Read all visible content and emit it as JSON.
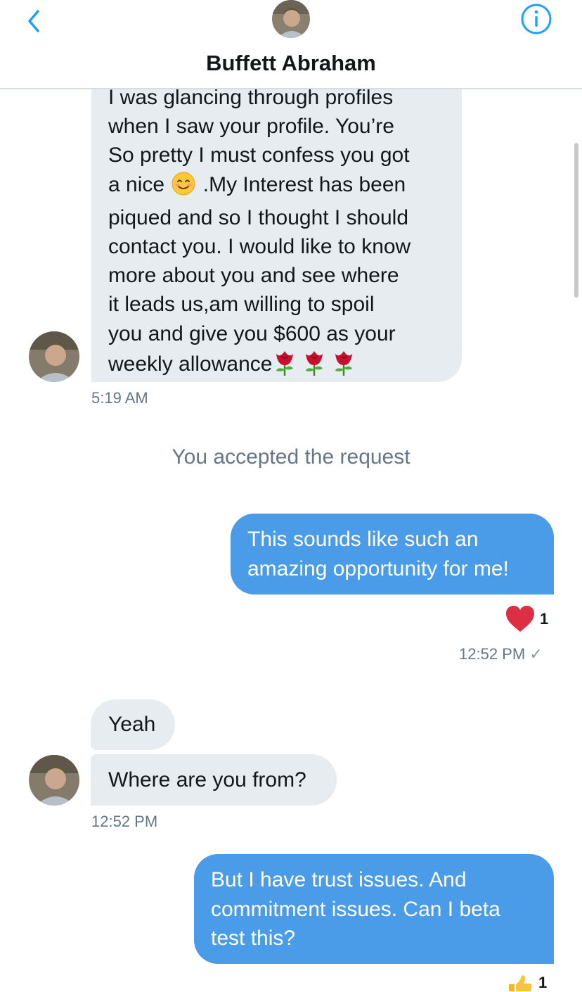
{
  "header": {
    "contact_name": "Buffett Abraham",
    "back_icon": "chevron-left-icon",
    "info_icon": "info-icon",
    "accent_color": "#1da1f2"
  },
  "messages": {
    "m1": {
      "lines": [
        "I was glancing through profiles",
        "when I saw your profile. You’re",
        "So pretty I must confess you got",
        "a nice",
        ".My Interest has been",
        "piqued and so I thought I should",
        "contact you. I would like to know",
        "more about you and see where",
        "it leads us,am willing to spoil",
        "you and give you $600 as your",
        "weekly allowance"
      ],
      "time": "5:19 AM"
    },
    "system_notice": "You accepted the request",
    "m2": {
      "lines": [
        "This sounds like such an",
        "amazing opportunity for me!"
      ],
      "reaction_icon": "heart-icon",
      "reaction_count": "1",
      "time": "12:52 PM",
      "status": "✓"
    },
    "m3": {
      "text": "Yeah"
    },
    "m4": {
      "text": "Where are you from?",
      "time": "12:52 PM"
    },
    "m5": {
      "lines": [
        "But I have trust issues.  And",
        "commitment issues.  Can I beta",
        "test this?"
      ],
      "reaction_icon": "thumbs-up-icon",
      "reaction_count": "1"
    }
  },
  "colors": {
    "incoming_bubble": "#e6ecf0",
    "outgoing_bubble": "#4a9be8",
    "secondary_text": "#657786",
    "heart": "#e0245e"
  }
}
